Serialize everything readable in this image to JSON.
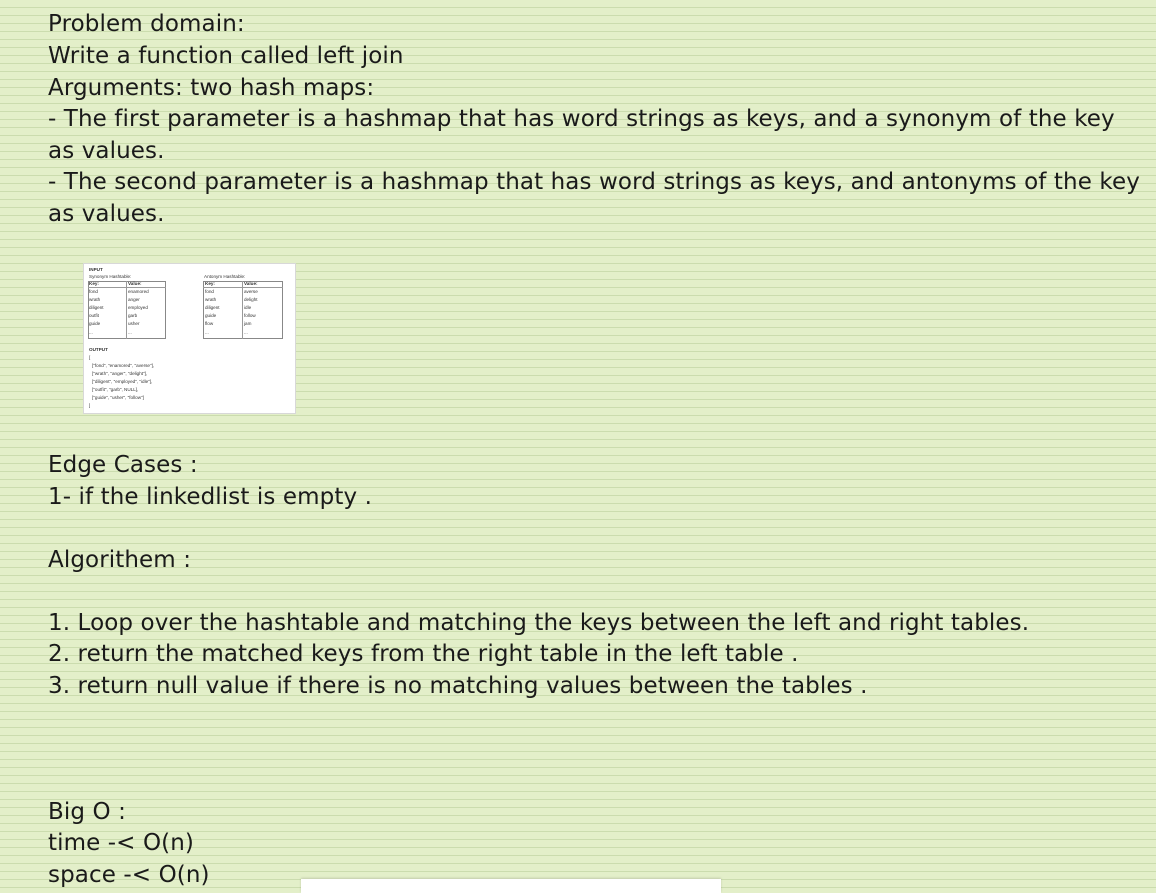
{
  "notes": {
    "problem_heading": "Problem domain:",
    "problem_line1": "Write a function called left join",
    "arguments_line": "Arguments: two hash maps:",
    "param1_line1": "- The first parameter is a hashmap that has word strings as keys, and a synonym of the key",
    "param1_line2": "as values.",
    "param2_line1": "- The second parameter is a hashmap that has word strings as keys, and antonyms of the key",
    "param2_line2": "as values.",
    "edge_heading": "Edge Cases :",
    "edge_item1": "1- if the linkedlist is empty .",
    "algo_heading": "Algorithem :",
    "algo_step1": "1. Loop over the hashtable and matching the keys between the left and right tables.",
    "algo_step2": "2. return the matched keys from the right table in the left table .",
    "algo_step3": "3. return null value if there is no matching values between the tables .",
    "bigo_heading": "Big O :",
    "bigo_time": "time -< O(n)",
    "bigo_space": "space -< O(n)"
  },
  "thumbnail": {
    "input_label": "INPUT",
    "synonym_title": "Synonym Hashtable:",
    "antonym_title": "Antonym Hashtable:",
    "key_header": "Key:",
    "value_header": "Value:",
    "synonym_keys": [
      "fond",
      "wrath",
      "diligent",
      "outfit",
      "guide",
      "..."
    ],
    "synonym_values": [
      "enamored",
      "anger",
      "employed",
      "garb",
      "usher",
      "..."
    ],
    "antonym_keys": [
      "fond",
      "wrath",
      "diligent",
      "guide",
      "flow",
      "..."
    ],
    "antonym_values": [
      "averse",
      "delight",
      "idle",
      "follow",
      "jam",
      "..."
    ],
    "output_label": "OUTPUT",
    "output_open": "[",
    "output_rows": [
      "[\"fond\", \"enamored\", \"averse\"],",
      "[\"wrath\", \"anger\", \"delight\"],",
      "[\"diligent\", \"employed\", \"idle\"],",
      "[\"outfit\", \"garb\", NULL],",
      "[\"guide\", \"usher\", \"follow\"]"
    ],
    "output_close": "]"
  }
}
